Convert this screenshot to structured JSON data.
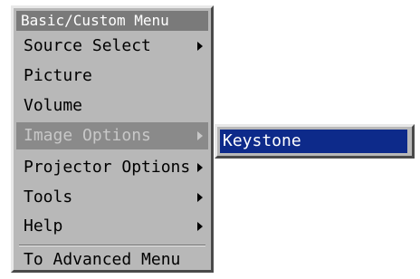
{
  "menu": {
    "title": "Basic/Custom Menu",
    "items": [
      {
        "label": "Source Select",
        "has_submenu": true,
        "selected": false
      },
      {
        "label": "Picture",
        "has_submenu": false,
        "selected": false
      },
      {
        "label": "Volume",
        "has_submenu": false,
        "selected": false
      },
      {
        "label": "Image Options",
        "has_submenu": true,
        "selected": true
      },
      {
        "label": "Projector Options",
        "has_submenu": true,
        "selected": false
      },
      {
        "label": "Tools",
        "has_submenu": true,
        "selected": false
      },
      {
        "label": "Help",
        "has_submenu": true,
        "selected": false
      }
    ],
    "footer_item": "To Advanced Menu"
  },
  "submenu": {
    "items": [
      {
        "label": "Keystone",
        "selected": true
      }
    ]
  },
  "colors": {
    "menu_background": "#b8b8b8",
    "title_background": "#7a7a7a",
    "selected_background": "#8a8a8a",
    "submenu_highlight": "#0d2a8a"
  },
  "icons": {
    "submenu_arrow": "chevron-right-icon"
  }
}
